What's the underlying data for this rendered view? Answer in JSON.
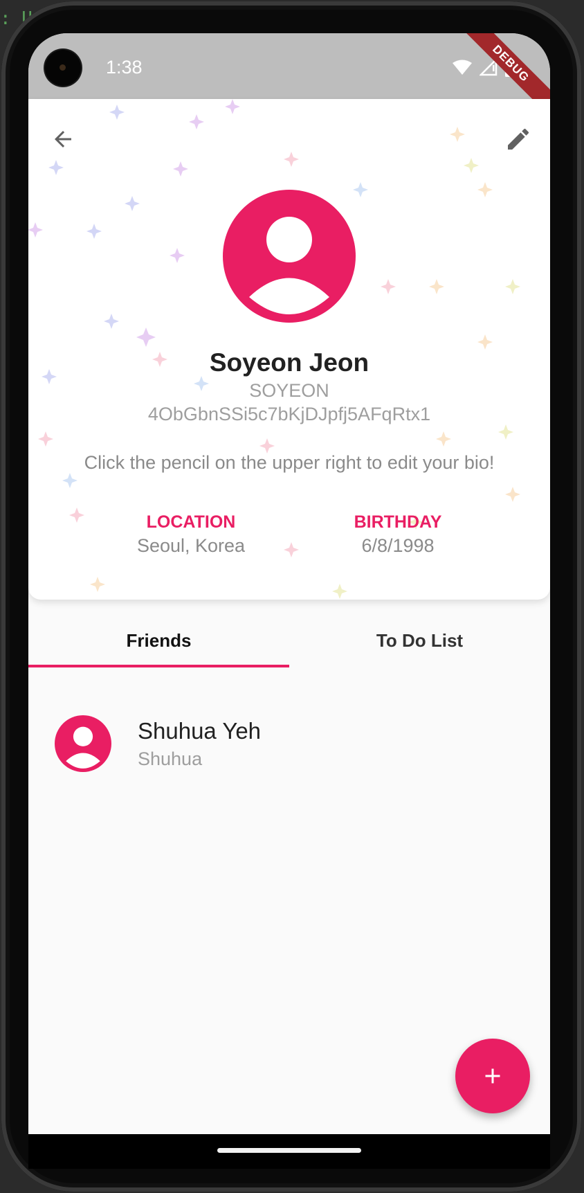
{
  "background": {
    "glyph": ": U"
  },
  "status_bar": {
    "time": "1:38",
    "debug_label": "DEBUG"
  },
  "header": {
    "back_icon": "arrow-back-icon",
    "edit_icon": "pencil-icon",
    "avatar_icon": "account-circle-icon",
    "name": "Soyeon Jeon",
    "username": "SOYEON",
    "uid": "4ObGbnSSi5c7bKjDJpfj5AFqRtx1",
    "bio": "Click the pencil on the upper right to edit your bio!",
    "location_label": "LOCATION",
    "location_value": "Seoul, Korea",
    "birthday_label": "BIRTHDAY",
    "birthday_value": "6/8/1998"
  },
  "tabs": [
    {
      "label": "Friends",
      "selected": true
    },
    {
      "label": "To Do List",
      "selected": false
    }
  ],
  "friends": [
    {
      "name": "Shuhua Yeh",
      "username": "Shuhua",
      "avatar_icon": "account-circle-icon"
    }
  ],
  "fab": {
    "icon": "plus-icon"
  },
  "colors": {
    "accent": "#e91e63",
    "status_bar": "#bdbdbd",
    "debug_banner": "#a2282b",
    "muted_text": "#9e9e9e",
    "screen_bg": "#fafafa"
  }
}
